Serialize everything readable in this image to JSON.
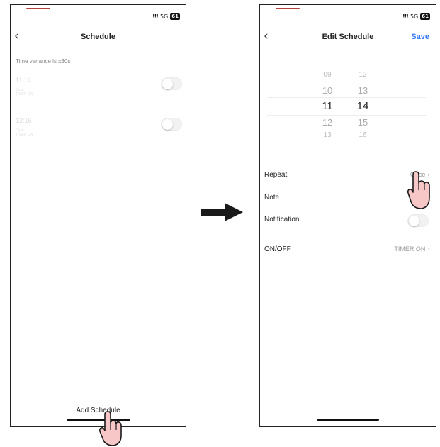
{
  "left_screen": {
    "status": {
      "signal": "!!!",
      "network": "5G",
      "battery": "61"
    },
    "back_icon": "back-chevron",
    "title": "Schedule",
    "variance_text": "Time variance is  ±30s",
    "schedules": [
      {
        "time": "11:14",
        "line1": "Once",
        "line2": "TIMER ON"
      },
      {
        "time": "13:16",
        "line1": "Once",
        "line2": "TIMER ON"
      }
    ],
    "add_button": "Add Schedule"
  },
  "right_screen": {
    "status": {
      "signal": "!!!",
      "network": "5G",
      "battery": "61"
    },
    "back_icon": "back-chevron",
    "title": "Edit Schedule",
    "save": "Save",
    "picker": {
      "hours": [
        "09",
        "10",
        "11",
        "12",
        "13"
      ],
      "minutes": [
        "12",
        "13",
        "14",
        "15",
        "16"
      ],
      "selected_hour": "11",
      "selected_minute": "14"
    },
    "rows": {
      "repeat": {
        "label": "Repeat",
        "value": "Once"
      },
      "note": {
        "label": "Note"
      },
      "notification": {
        "label": "Notification"
      },
      "onoff": {
        "label": "ON/OFF",
        "value": "TIMER ON"
      }
    }
  },
  "colors": {
    "accent": "#3478f6",
    "arrow": "#1a1a1a",
    "hand_fill": "#f7c6c6"
  }
}
